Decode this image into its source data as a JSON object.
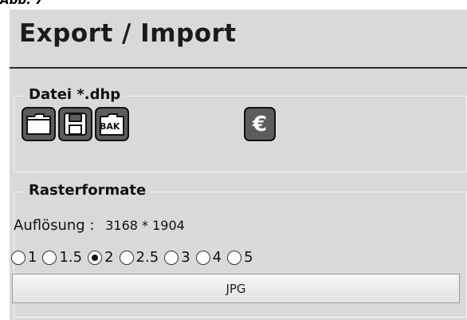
{
  "caption": "Abb. 7",
  "header": {
    "title": "Export / Import"
  },
  "datei_group": {
    "label": "Datei *.dhp",
    "buttons": [
      {
        "icon": "folder-icon"
      },
      {
        "icon": "save-disk-icon"
      },
      {
        "icon": "backup-icon",
        "text": "BAK"
      },
      {
        "icon": "euro-icon",
        "text": "€"
      }
    ]
  },
  "raster_group": {
    "label": "Rasterformate",
    "resolution_label": "Auflösung :",
    "resolution_value": "3168 * 1904",
    "scale_options": [
      "1",
      "1.5",
      "2",
      "2.5",
      "3",
      "4",
      "5"
    ],
    "selected_option": "2",
    "export_button": "JPG"
  },
  "colors": {
    "panel": "#d9d9d9",
    "icon_fill": "#5c5c5c",
    "icon_border": "#111111"
  }
}
